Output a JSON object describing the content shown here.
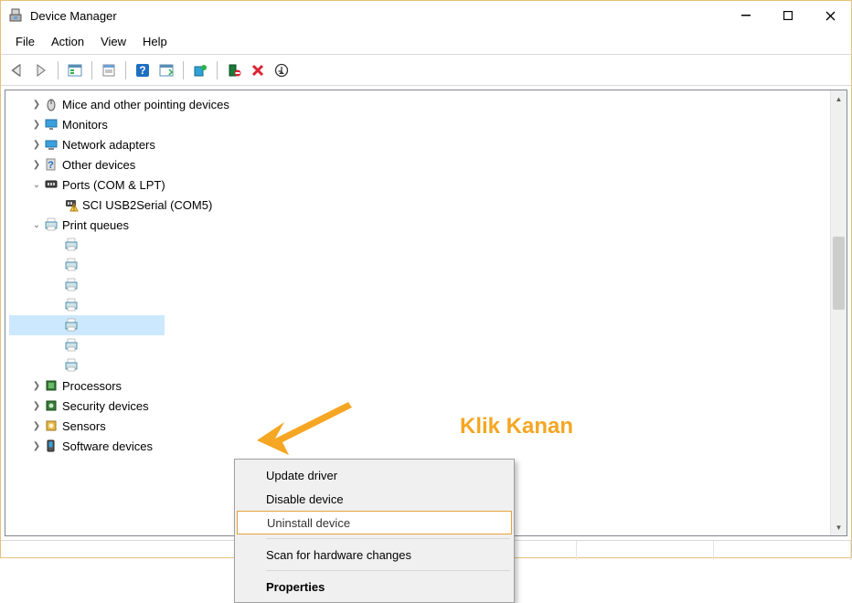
{
  "window": {
    "title": "Device Manager"
  },
  "menubar": {
    "items": [
      "File",
      "Action",
      "View",
      "Help"
    ]
  },
  "toolbar_icons": [
    "back",
    "forward",
    "sep",
    "show-all",
    "sep",
    "properties",
    "sep",
    "help",
    "scan",
    "sep",
    "update-driver",
    "sep",
    "uninstall",
    "delete",
    "circle-down"
  ],
  "tree": {
    "nodes": [
      {
        "indent": 1,
        "exp": ">",
        "icon": "mouse-icon",
        "label": "Mice and other pointing devices"
      },
      {
        "indent": 1,
        "exp": ">",
        "icon": "monitor-icon",
        "label": "Monitors"
      },
      {
        "indent": 1,
        "exp": ">",
        "icon": "network-icon",
        "label": "Network adapters"
      },
      {
        "indent": 1,
        "exp": ">",
        "icon": "question-icon",
        "label": "Other devices"
      },
      {
        "indent": 1,
        "exp": "v",
        "icon": "port-icon",
        "label": "Ports (COM & LPT)"
      },
      {
        "indent": 2,
        "exp": "",
        "icon": "port-warn-icon",
        "label": "SCI USB2Serial (COM5)"
      },
      {
        "indent": 1,
        "exp": "v",
        "icon": "printer-icon",
        "label": "Print queues"
      },
      {
        "indent": 2,
        "exp": "",
        "icon": "printer-icon",
        "label": ""
      },
      {
        "indent": 2,
        "exp": "",
        "icon": "printer-icon",
        "label": ""
      },
      {
        "indent": 2,
        "exp": "",
        "icon": "printer-icon",
        "label": ""
      },
      {
        "indent": 2,
        "exp": "",
        "icon": "printer-icon",
        "label": ""
      },
      {
        "indent": 2,
        "exp": "",
        "icon": "printer-icon",
        "label": "",
        "selected": true
      },
      {
        "indent": 2,
        "exp": "",
        "icon": "printer-icon",
        "label": ""
      },
      {
        "indent": 2,
        "exp": "",
        "icon": "printer-icon",
        "label": ""
      },
      {
        "indent": 1,
        "exp": ">",
        "icon": "processor-icon",
        "label": "Processors"
      },
      {
        "indent": 1,
        "exp": ">",
        "icon": "security-icon",
        "label": "Security devices"
      },
      {
        "indent": 1,
        "exp": ">",
        "icon": "sensor-icon",
        "label": "Sensors"
      },
      {
        "indent": 1,
        "exp": ">",
        "icon": "software-icon",
        "label": "Software devices"
      }
    ]
  },
  "context_menu": {
    "items": [
      {
        "label": "Update driver",
        "type": "item"
      },
      {
        "label": "Disable device",
        "type": "item"
      },
      {
        "label": "Uninstall device",
        "type": "item",
        "hover": true
      },
      {
        "type": "sep"
      },
      {
        "label": "Scan for hardware changes",
        "type": "item"
      },
      {
        "type": "sep"
      },
      {
        "label": "Properties",
        "type": "item",
        "bold": true
      }
    ]
  },
  "annotation": {
    "text": "Klik Kanan"
  }
}
